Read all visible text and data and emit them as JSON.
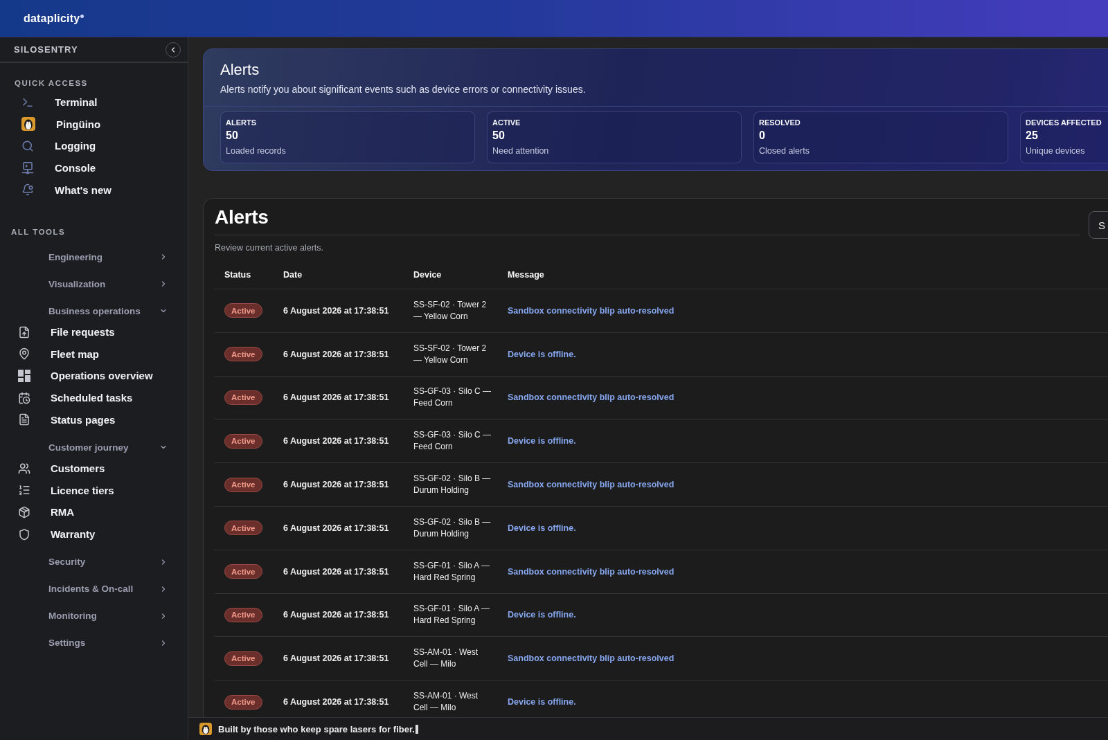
{
  "header": {
    "brand": "dataplicity"
  },
  "sidebar": {
    "workspace": "SILOSENTRY",
    "quick_access": {
      "heading": "QUICK ACCESS",
      "items": [
        {
          "label": "Terminal"
        },
        {
          "label": "Pingüino"
        },
        {
          "label": "Logging"
        },
        {
          "label": "Console"
        },
        {
          "label": "What's new"
        }
      ]
    },
    "all_tools": {
      "heading": "ALL TOOLS",
      "groups": [
        {
          "label": "Engineering",
          "expanded": false
        },
        {
          "label": "Visualization",
          "expanded": false
        },
        {
          "label": "Business operations",
          "expanded": true,
          "children": [
            {
              "label": "File requests"
            },
            {
              "label": "Fleet map"
            },
            {
              "label": "Operations overview"
            },
            {
              "label": "Scheduled tasks"
            },
            {
              "label": "Status pages"
            }
          ]
        },
        {
          "label": "Customer journey",
          "expanded": true,
          "children": [
            {
              "label": "Customers"
            },
            {
              "label": "Licence tiers"
            },
            {
              "label": "RMA"
            },
            {
              "label": "Warranty"
            }
          ]
        },
        {
          "label": "Security",
          "expanded": false
        },
        {
          "label": "Incidents & On-call",
          "expanded": false
        },
        {
          "label": "Monitoring",
          "expanded": false
        },
        {
          "label": "Settings",
          "expanded": false
        }
      ]
    }
  },
  "hero": {
    "title": "Alerts",
    "subtitle": "Alerts notify you about significant events such as device errors or connectivity issues.",
    "stats": [
      {
        "label": "ALERTS",
        "value": "50",
        "caption": "Loaded records"
      },
      {
        "label": "ACTIVE",
        "value": "50",
        "caption": "Need attention"
      },
      {
        "label": "RESOLVED",
        "value": "0",
        "caption": "Closed alerts"
      },
      {
        "label": "DEVICES AFFECTED",
        "value": "25",
        "caption": "Unique devices"
      }
    ]
  },
  "alerts_table": {
    "title": "Alerts",
    "description": "Review current active alerts.",
    "action_button": "S",
    "columns": [
      "Status",
      "Date",
      "Device",
      "Message"
    ],
    "rows": [
      {
        "status": "Active",
        "date": "6 August 2026 at 17:38:51",
        "device": "SS-SF-02 · Tower 2 — Yellow Corn",
        "message": "Sandbox connectivity blip auto-resolved"
      },
      {
        "status": "Active",
        "date": "6 August 2026 at 17:38:51",
        "device": "SS-SF-02 · Tower 2 — Yellow Corn",
        "message": "Device is offline."
      },
      {
        "status": "Active",
        "date": "6 August 2026 at 17:38:51",
        "device": "SS-GF-03 · Silo C — Feed Corn",
        "message": "Sandbox connectivity blip auto-resolved"
      },
      {
        "status": "Active",
        "date": "6 August 2026 at 17:38:51",
        "device": "SS-GF-03 · Silo C — Feed Corn",
        "message": "Device is offline."
      },
      {
        "status": "Active",
        "date": "6 August 2026 at 17:38:51",
        "device": "SS-GF-02 · Silo B — Durum Holding",
        "message": "Sandbox connectivity blip auto-resolved"
      },
      {
        "status": "Active",
        "date": "6 August 2026 at 17:38:51",
        "device": "SS-GF-02 · Silo B — Durum Holding",
        "message": "Device is offline."
      },
      {
        "status": "Active",
        "date": "6 August 2026 at 17:38:51",
        "device": "SS-GF-01 · Silo A — Hard Red Spring",
        "message": "Sandbox connectivity blip auto-resolved"
      },
      {
        "status": "Active",
        "date": "6 August 2026 at 17:38:51",
        "device": "SS-GF-01 · Silo A — Hard Red Spring",
        "message": "Device is offline."
      },
      {
        "status": "Active",
        "date": "6 August 2026 at 17:38:51",
        "device": "SS-AM-01 · West Cell — Milo",
        "message": "Sandbox connectivity blip auto-resolved"
      },
      {
        "status": "Active",
        "date": "6 August 2026 at 17:38:51",
        "device": "SS-AM-01 · West Cell — Milo",
        "message": "Device is offline."
      }
    ]
  },
  "footer": {
    "text": "Built by those who keep spare lasers for fiber."
  }
}
